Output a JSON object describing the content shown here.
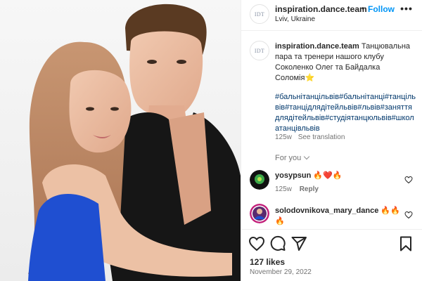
{
  "post": {
    "username": "inspiration.dance.team",
    "follow_label": "Follow",
    "separator": "•",
    "location": "Lviv, Ukraine",
    "logo_text": "IDT",
    "more_icon": "more-horizontal-icon",
    "photo_alt": "Dance couple photo"
  },
  "caption": {
    "username": "inspiration.dance.team",
    "text": "Танцювальна пара та тренери нашого клубу Соколенко Олег та Байдалка Соломія⭐",
    "hashtags": "#бальнітанцільвів#бальнітанці#танцільвів#танцідлядітейльвів#львів#заняттядлядітейльвів#студіятанцюльвів#школатанцівльвів",
    "age": "125w",
    "see_translation": "See translation"
  },
  "for_you": {
    "label": "For you"
  },
  "comments": [
    {
      "username": "yosypsun",
      "text": "🔥❤️🔥",
      "age": "125w",
      "reply_label": "Reply"
    },
    {
      "username": "solodovnikova_mary_dance",
      "text": "🔥🔥",
      "text2": "🔥"
    }
  ],
  "actions": {
    "like_icon": "heart-icon",
    "comment_icon": "comment-icon",
    "share_icon": "share-icon",
    "save_icon": "bookmark-icon"
  },
  "likes": "127 likes",
  "date": "November 29, 2022",
  "colors": {
    "accent": "#0095f6",
    "hashtag": "#00376b",
    "muted": "#737373",
    "dress": "#1f4fd1",
    "shirt": "#161616"
  }
}
